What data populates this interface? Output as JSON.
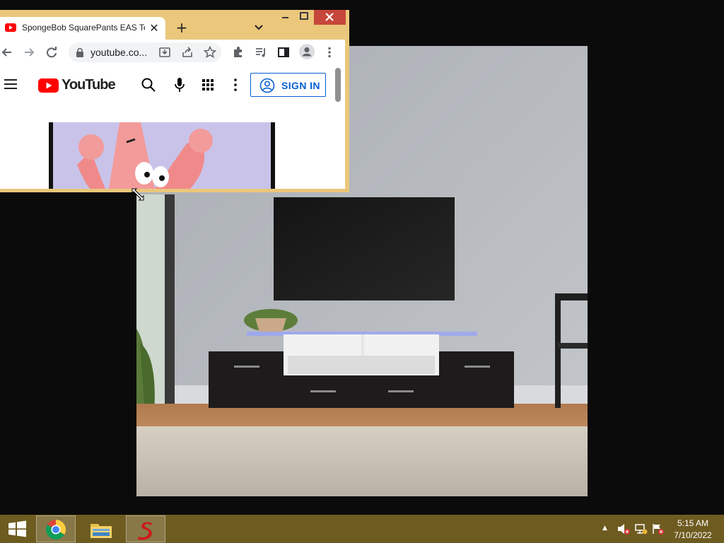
{
  "browser": {
    "tab": {
      "title": "SpongeBob SquarePants EAS Tes",
      "close_glyph": "✕",
      "favicon": "youtube-favicon"
    },
    "new_tab_glyph": "+",
    "tab_search_icon": "chevron-down-icon",
    "window_buttons": [
      "minimize-icon",
      "maximize-icon",
      "close-icon"
    ],
    "toolbar": {
      "url": "youtube.co...",
      "icons": [
        "back-icon",
        "forward-icon",
        "reload-icon",
        "lock-icon",
        "install-icon",
        "share-icon",
        "star-icon",
        "extensions-icon",
        "media-icon",
        "side-panel-icon",
        "profile-icon",
        "menu-icon"
      ]
    },
    "frame_color": "#eac77a"
  },
  "youtube": {
    "logo_text": "YouTube",
    "sign_in_label": "SIGN IN",
    "accent": "#065fd4",
    "brand_red": "#ff0000",
    "icons": [
      "hamburger-menu-icon",
      "search-icon",
      "microphone-icon",
      "apps-grid-icon",
      "more-vert-icon",
      "account-circle-icon"
    ]
  },
  "taskbar": {
    "color": "#6e5b20",
    "apps": [
      "chrome-icon",
      "file-explorer-icon",
      "s-app-icon"
    ],
    "tray_chevron": "▲",
    "tray_icons": [
      "speaker-muted-icon",
      "network-icon",
      "action-center-flag-icon"
    ],
    "time": "5:15 AM",
    "date": "7/10/2022"
  }
}
